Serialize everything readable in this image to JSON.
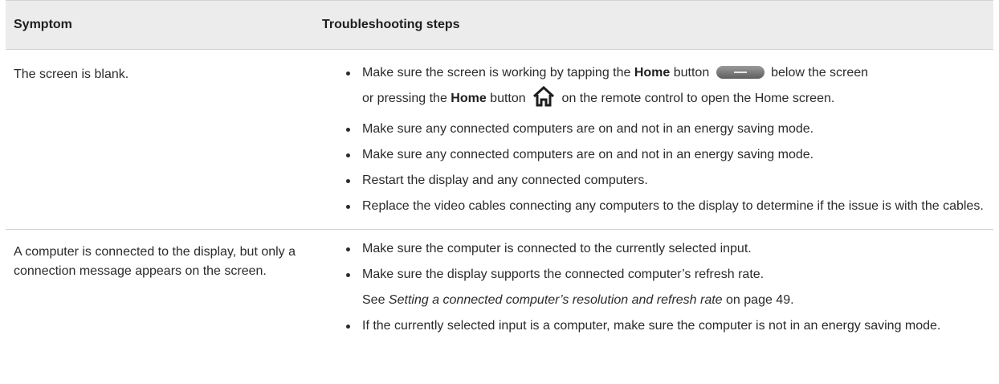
{
  "header": {
    "symptom": "Symptom",
    "steps": "Troubleshooting steps"
  },
  "rows": [
    {
      "symptom": "The screen is blank.",
      "steps": [
        {
          "a": "Make sure the screen is working by tapping the ",
          "bold1": "Home",
          "b": " button ",
          "c": " below the screen",
          "d": "or pressing the ",
          "bold2": "Home",
          "e": " button ",
          "f": " on the remote control to open the Home screen."
        },
        {
          "text": "Make sure any connected computers are on and not in an energy saving mode."
        },
        {
          "text": "Make sure any connected computers are on and not in an energy saving mode."
        },
        {
          "text": "Restart the display and any connected computers."
        },
        {
          "text": "Replace the video cables connecting any computers to the display to determine if the issue is with the cables."
        }
      ]
    },
    {
      "symptom": "A computer is connected to the display, but only a connection message appears on the screen.",
      "steps": [
        {
          "text": "Make sure the computer is connected to the currently selected input."
        },
        {
          "text": "Make sure the display supports the connected computer’s refresh rate.",
          "see": "See ",
          "link": "Setting a connected computer’s resolution and refresh rate",
          "page": " on page 49."
        },
        {
          "text": "If the currently selected input is a computer, make sure the computer is not in an energy saving mode."
        }
      ]
    }
  ],
  "icons": {
    "home_button": "home-button-bar-icon",
    "remote_home": "home-icon"
  }
}
